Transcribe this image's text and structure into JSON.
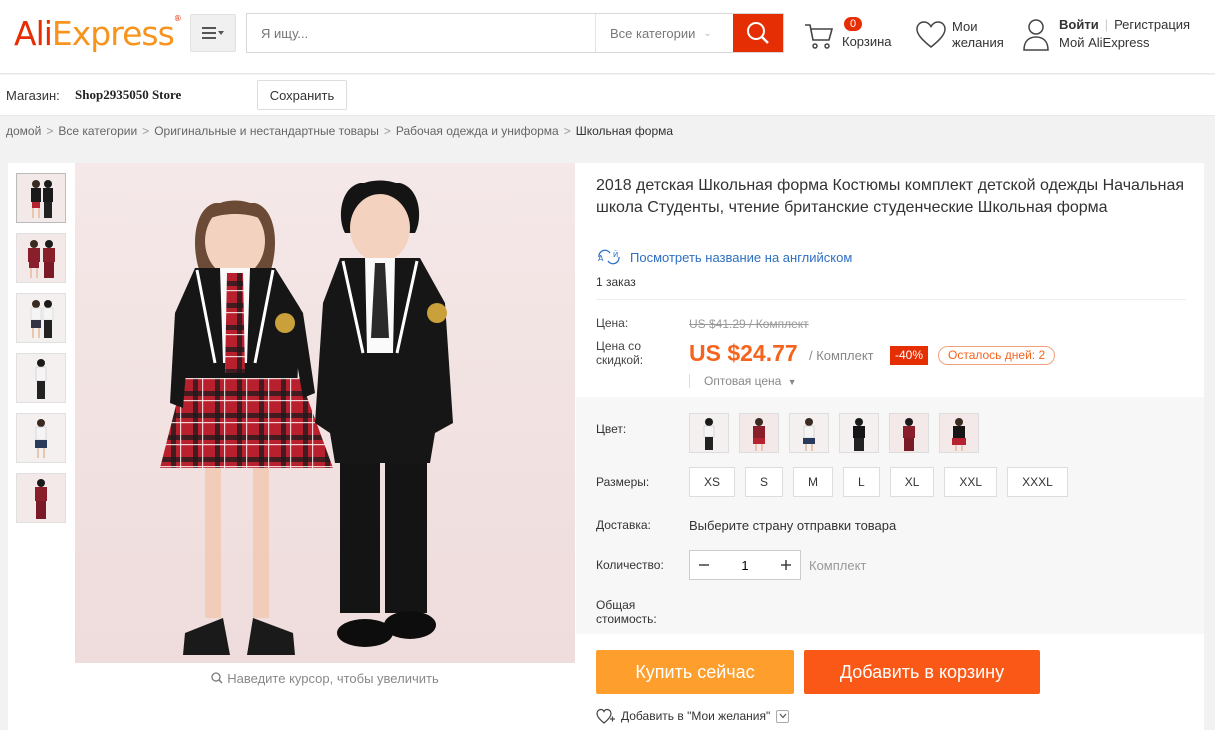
{
  "header": {
    "logo_ali": "Ali",
    "logo_express": "Express",
    "logo_tm": "®",
    "search_placeholder": "Я ищу...",
    "category_select": "Все категории",
    "cart_count": "0",
    "cart_label": "Корзина",
    "wishlist_line1": "Мои",
    "wishlist_line2": "желания",
    "login": "Войти",
    "register": "Регистрация",
    "my_account": "Мой AliExpress"
  },
  "store": {
    "label": "Магазин:",
    "name": "Shop2935050 Store",
    "save_button": "Сохранить"
  },
  "breadcrumb": [
    "домой",
    "Все категории",
    "Оригинальные и нестандартные товары",
    "Рабочая одежда и униформа",
    "Школьная форма"
  ],
  "gallery": {
    "zoom_hint": "Наведите курсор, чтобы увеличить",
    "thumbnail_count": 6
  },
  "product": {
    "title": "2018 детская Школьная форма Костюмы комплект детской одежды Начальная школа Студенты, чтение британские студенческие Школьная форма",
    "translate_link": "Посмотреть название на английском",
    "orders": "1 заказ",
    "price_label": "Цена:",
    "old_price": "US $41.29 / Комплект",
    "discount_price_label": "Цена со скидкой:",
    "price": "US $24.77",
    "per_unit": "/ Комплект",
    "discount": "-40%",
    "days_left": "Осталось дней: 2",
    "wholesale": "Оптовая цена",
    "color_label": "Цвет:",
    "sizes_label": "Размеры:",
    "sizes": [
      "XS",
      "S",
      "M",
      "L",
      "XL",
      "XXL",
      "XXXL"
    ],
    "shipping_label": "Доставка:",
    "shipping_value": "Выберите страну отправки товара",
    "quantity_label": "Количество:",
    "quantity": "1",
    "quantity_unit": "Комплект",
    "total_label": "Общая стоимость:",
    "buy_now": "Купить сейчас",
    "add_to_cart": "Добавить в корзину",
    "add_to_wishlist": "Добавить в \"Мои желания\""
  },
  "colors": {
    "brand_red": "#e62e04",
    "brand_orange": "#f7941d",
    "price_orange": "#f5641e",
    "buy_button": "#fe9e2d",
    "cart_button": "#fa5816",
    "link_blue": "#2d6fc4"
  }
}
